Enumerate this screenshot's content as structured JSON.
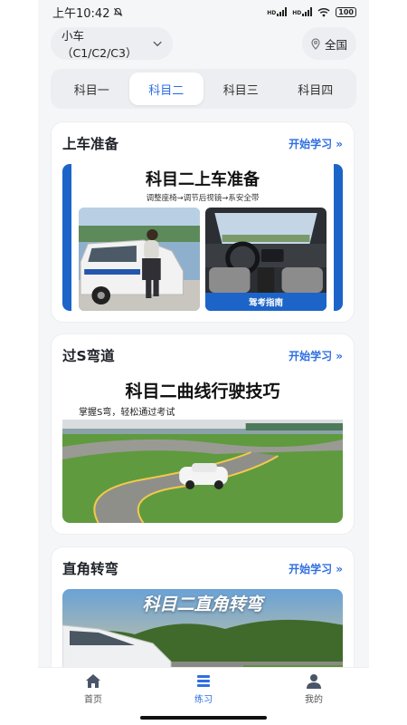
{
  "status": {
    "time": "上午10:42",
    "battery": "100",
    "net1": "HD",
    "net2": "HD"
  },
  "topbar": {
    "car_type": "小车（C1/C2/C3）",
    "region": "全国"
  },
  "tabs": [
    {
      "label": "科目一",
      "active": false
    },
    {
      "label": "科目二",
      "active": true
    },
    {
      "label": "科目三",
      "active": false
    },
    {
      "label": "科目四",
      "active": false
    }
  ],
  "cards": [
    {
      "title": "上车准备",
      "link": "开始学习 »",
      "image_title": "科目二上车准备",
      "image_subtitle": "调整座椅→调节后视镜→系安全带",
      "image_badge": "驾考指南"
    },
    {
      "title": "过S弯道",
      "link": "开始学习 »",
      "image_title": "科目二曲线行驶技巧",
      "image_subtitle": "掌握S弯，轻松通过考试"
    },
    {
      "title": "直角转弯",
      "link": "开始学习 »",
      "image_title": "科目二直角转弯"
    }
  ],
  "nav": [
    {
      "label": "首页",
      "icon": "home-icon",
      "active": false
    },
    {
      "label": "练习",
      "icon": "list-icon",
      "active": true
    },
    {
      "label": "我的",
      "icon": "user-icon",
      "active": false
    }
  ],
  "colors": {
    "accent": "#2f6fe0",
    "banner_blue": "#1d64c8",
    "background": "#f5f6f8"
  }
}
